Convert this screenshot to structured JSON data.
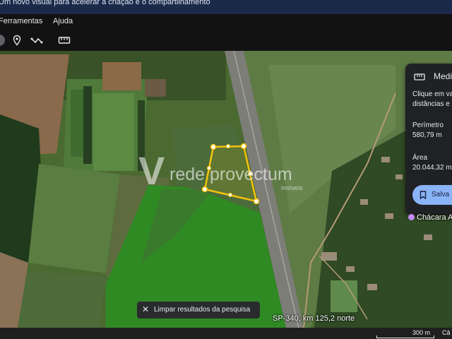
{
  "banner": {
    "text": "Um novo visual para acelerar a criação e o compartilhamento"
  },
  "menu": {
    "items": [
      "Ferramentas",
      "Ajuda"
    ]
  },
  "toolbar": {
    "icons": [
      "partial-button-icon",
      "pin-icon",
      "path-icon",
      "ruler-icon"
    ]
  },
  "panel": {
    "title": "Medi",
    "desc_line1": "Clique em va",
    "desc_line2": "distâncias e",
    "perimeter_label": "Perímetro",
    "perimeter_value": "580,79 m",
    "area_label": "Área",
    "area_value": "20.044,32 m",
    "save_label": "Salva"
  },
  "search_chip": {
    "label": "Limpar resultados da pesquisa"
  },
  "map": {
    "road_label": "SP-340, km 125,2 norte",
    "place_label": "Chácara Andr",
    "watermark_brand": "rede provectum",
    "watermark_sub": "imóveis"
  },
  "scale": {
    "label": "300 m",
    "right_text": "Câ"
  },
  "colors": {
    "accent": "#8ab4f8",
    "polygon": "#f4c20d"
  }
}
